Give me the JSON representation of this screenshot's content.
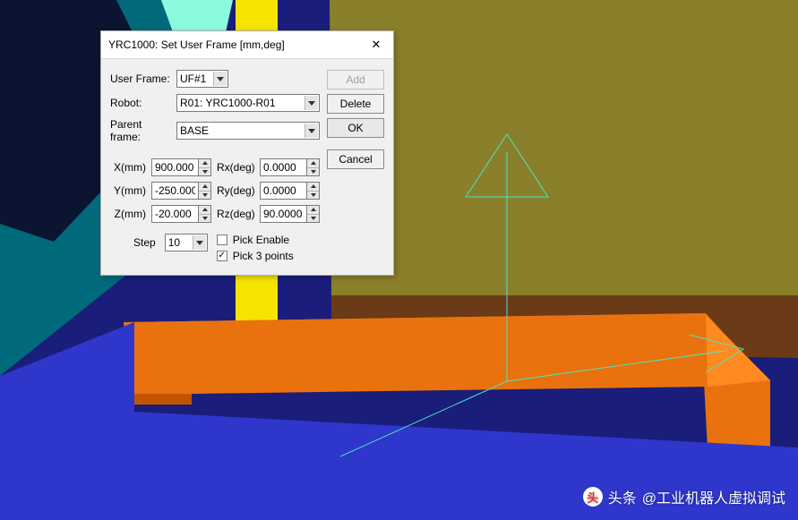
{
  "dialog": {
    "title": "YRC1000: Set User Frame [mm,deg]",
    "labels": {
      "user_frame": "User Frame:",
      "robot": "Robot:",
      "parent_frame": "Parent frame:",
      "x": "X(mm)",
      "y": "Y(mm)",
      "z": "Z(mm)",
      "rx": "Rx(deg)",
      "ry": "Ry(deg)",
      "rz": "Rz(deg)",
      "step": "Step",
      "pick_enable": "Pick Enable",
      "pick_3_points": "Pick 3 points"
    },
    "buttons": {
      "add": "Add",
      "delete": "Delete",
      "ok": "OK",
      "cancel": "Cancel"
    },
    "values": {
      "user_frame": "UF#1",
      "robot": "R01: YRC1000-R01",
      "parent_frame": "BASE",
      "x": "900.000",
      "y": "-250.000",
      "z": "-20.000",
      "rx": "0.0000",
      "ry": "0.0000",
      "rz": "90.0000",
      "step": "10",
      "pick_enable": false,
      "pick_3_points": true
    }
  },
  "watermark": {
    "prefix": "头条",
    "user": "@工业机器人虚拟调试"
  }
}
